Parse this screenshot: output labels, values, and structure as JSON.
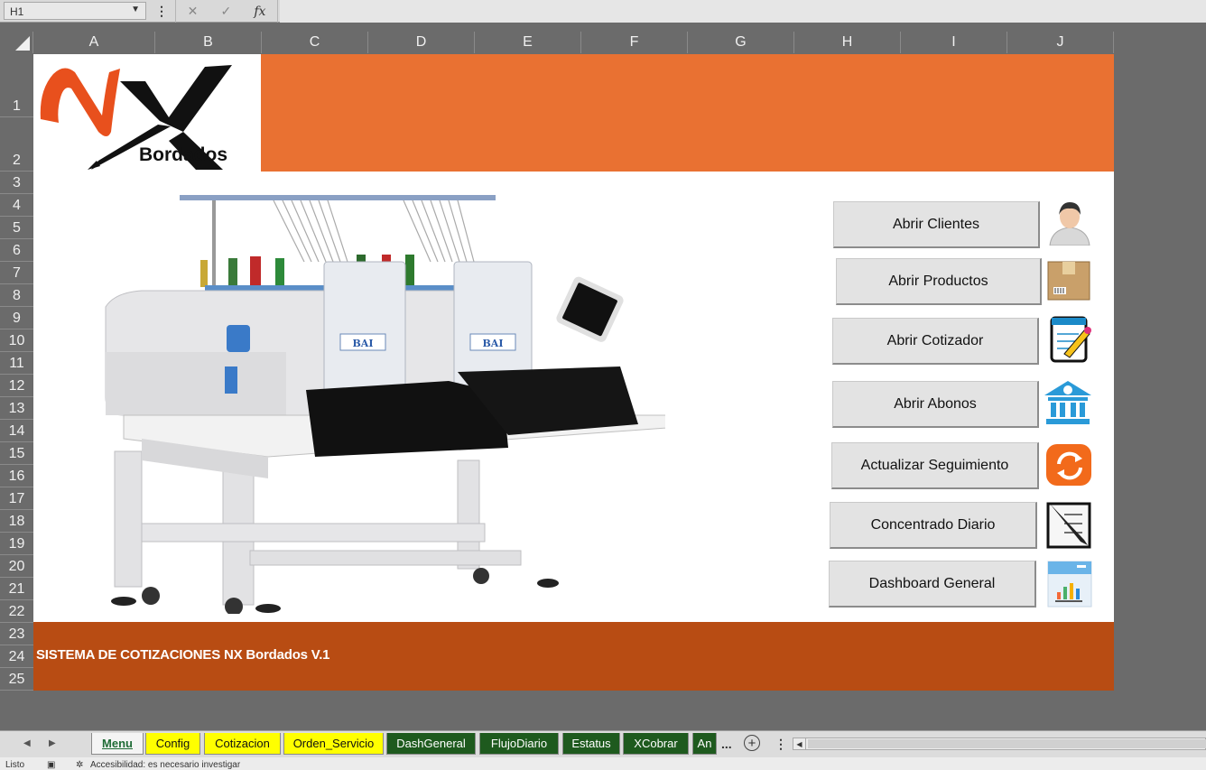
{
  "formula_bar": {
    "cell_ref": "H1",
    "more": "⋮",
    "cancel": "✕",
    "enter": "✓",
    "fx": "fx"
  },
  "columns": [
    "A",
    "B",
    "C",
    "D",
    "E",
    "F",
    "G",
    "H",
    "I",
    "J"
  ],
  "rows": [
    "1",
    "2",
    "3",
    "4",
    "5",
    "6",
    "7",
    "8",
    "9",
    "10",
    "11",
    "12",
    "13",
    "14",
    "15",
    "16",
    "17",
    "18",
    "19",
    "20",
    "21",
    "22",
    "23",
    "24",
    "25"
  ],
  "logo": {
    "brand": "NX",
    "sub": "Bordados"
  },
  "buttons": {
    "clientes": "Abrir Clientes",
    "productos": "Abrir Productos",
    "cotizador": "Abrir Cotizador",
    "abonos": "Abrir Abonos",
    "seguimiento": "Actualizar Seguimiento",
    "concentrado": "Concentrado Diario",
    "dashboard": "Dashboard General"
  },
  "footer": {
    "title": "SISTEMA DE COTIZACIONES NX Bordados V.1"
  },
  "machine": {
    "head_label": "BAI"
  },
  "tabs": [
    "Menu",
    "Config",
    "Cotizacion",
    "Orden_Servicio",
    "DashGeneral",
    "FlujoDiario",
    "Estatus",
    "XCobrar",
    "An"
  ],
  "tabs_more": "...",
  "status": {
    "ready": "Listo",
    "accessibility": "Accesibilidad: es necesario investigar"
  },
  "colors": {
    "orange": "#e97132",
    "dark_orange": "#b84c13",
    "tab_yellow": "#ffff00",
    "tab_green": "#1e5a1e"
  }
}
